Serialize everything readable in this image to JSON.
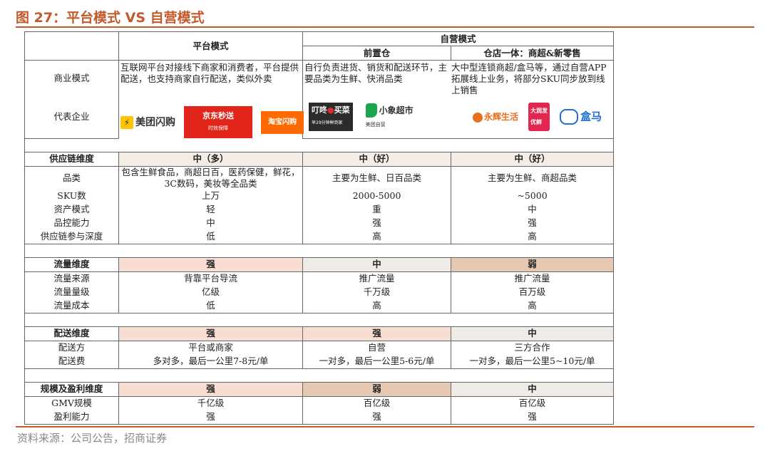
{
  "figure": {
    "title": "图 27：平台模式 VS 自营模式",
    "source": "资料来源：公司公告，招商证券"
  },
  "headers": {
    "platform": "平台模式",
    "self": "自营模式",
    "front_warehouse": "前置仓",
    "store_warehouse": "仓店一体：商超&新零售"
  },
  "business_model": {
    "label": "商业模式",
    "platform": "互联网平台对接线下商家和消费者，平台提供配送，也支持商家自行配送，类似外卖",
    "self_front": "自行负责进货、销货和配送环节，主要品类为生鲜、快消品类",
    "self_store": "大中型连锁商超/盒马等，通过自营APP拓展线上业务，将部分SKU同步放到线上销售"
  },
  "companies": {
    "label": "代表企业",
    "platform_logos": [
      "美团闪购",
      "京东秒送",
      "淘宝闪购"
    ],
    "front_logos": [
      "叮咚",
      "买菜",
      "小象超市"
    ],
    "store_logos": [
      "永辉生活",
      "大润发",
      "盒马"
    ],
    "logo_subtext": {
      "jd": "时效保障",
      "dingdong": "早29分钟鲜到家",
      "xiaoxiang": "美团自营",
      "runfa": "优鲜"
    }
  },
  "sections": [
    {
      "title": "供应链维度",
      "values": [
        "中（多）",
        "中（好）",
        "中（好）"
      ],
      "fills": [
        "light",
        "light",
        "light"
      ],
      "rows": [
        {
          "label": "品类",
          "values": [
            "包含生鲜食品，商超日百，医药保健，鲜花，3C数码，美妆等全品类",
            "主要为生鲜、日百品类",
            "主要为生鲜、商超品类"
          ]
        },
        {
          "label": "SKU数",
          "values": [
            "上万",
            "2000-5000",
            "~5000"
          ]
        },
        {
          "label": "资产模式",
          "values": [
            "轻",
            "重",
            "中"
          ]
        },
        {
          "label": "品控能力",
          "values": [
            "中",
            "强",
            "强"
          ]
        },
        {
          "label": "供应链参与深度",
          "values": [
            "低",
            "高",
            "高"
          ]
        }
      ]
    },
    {
      "title": "流量维度",
      "values": [
        "强",
        "中",
        "弱"
      ],
      "fills": [
        "peach",
        "grey",
        "tan"
      ],
      "rows": [
        {
          "label": "流量来源",
          "values": [
            "背靠平台导流",
            "推广流量",
            "推广流量"
          ]
        },
        {
          "label": "流量量级",
          "values": [
            "亿级",
            "千万级",
            "百万级"
          ]
        },
        {
          "label": "流量成本",
          "values": [
            "低",
            "高",
            "高"
          ]
        }
      ]
    },
    {
      "title": "配送维度",
      "values": [
        "强",
        "强",
        "中"
      ],
      "fills": [
        "peach",
        "peach",
        "grey"
      ],
      "rows": [
        {
          "label": "配送方",
          "values": [
            "平台或商家",
            "自营",
            "三方合作"
          ]
        },
        {
          "label": "配送费",
          "values": [
            "多对多，最后一公里7-8元/单",
            "一对多，最后一公里5-6元/单",
            "一对多，最后一公里5~10元/单"
          ]
        }
      ]
    },
    {
      "title": "规模及盈利维度",
      "values": [
        "强",
        "弱",
        "中"
      ],
      "fills": [
        "peach",
        "tan",
        "grey"
      ],
      "rows": [
        {
          "label": "GMV规模",
          "values": [
            "千亿级",
            "百亿级",
            "百亿级"
          ]
        },
        {
          "label": "盈利能力",
          "values": [
            "强",
            "强",
            "强"
          ]
        }
      ]
    }
  ],
  "colors": {
    "accent": "#c35a2a",
    "peach": "#f8ddd2",
    "tan": "#e7c9b3",
    "light": "#f3ede6",
    "grey": "#efece8"
  }
}
